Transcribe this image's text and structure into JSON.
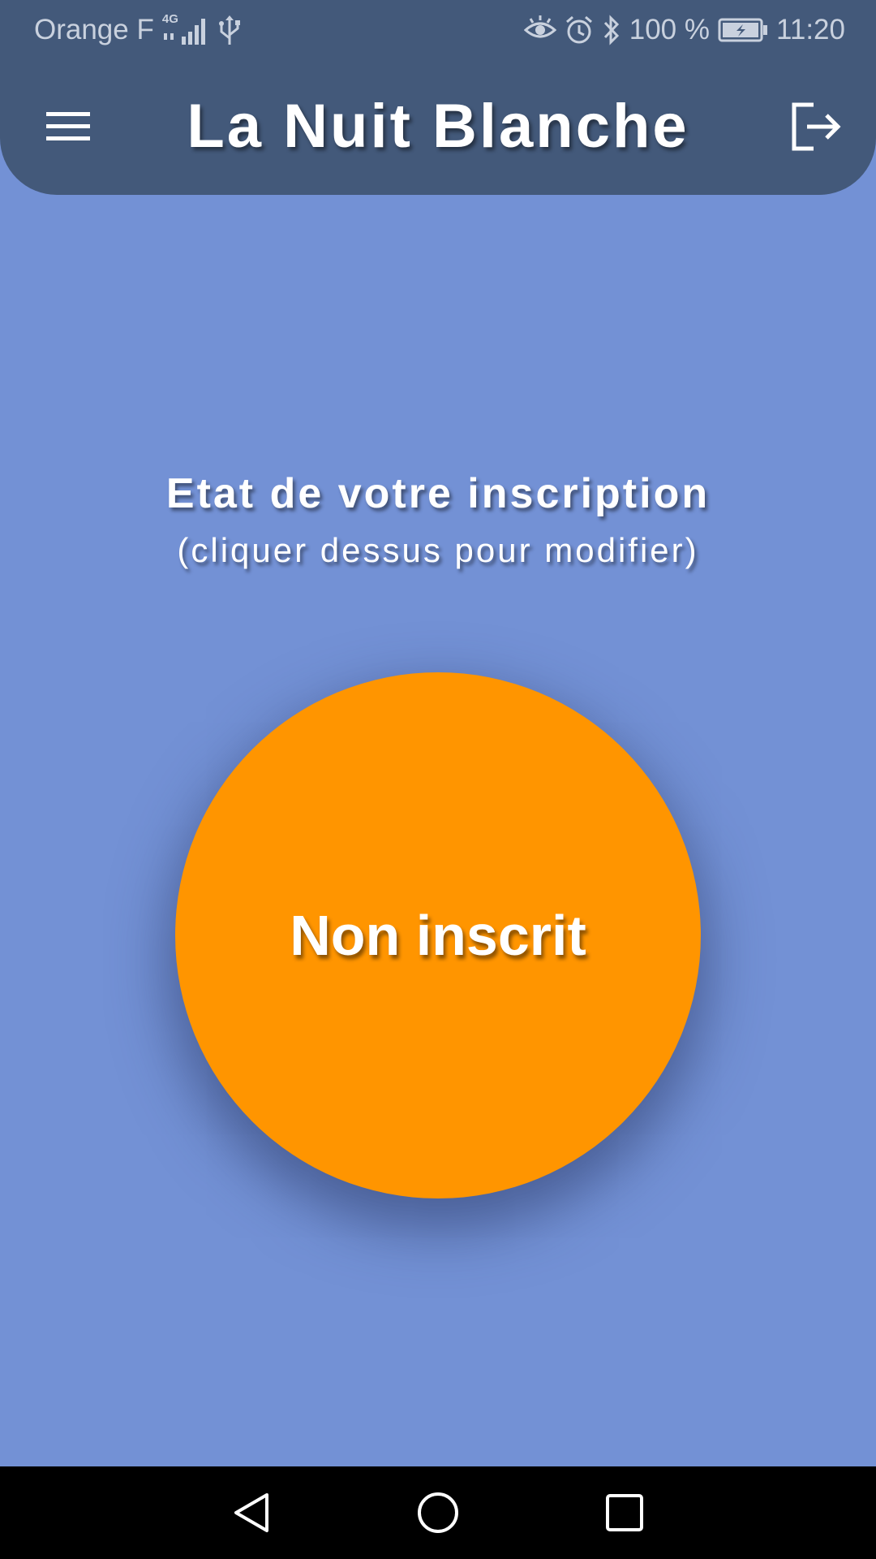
{
  "status_bar": {
    "carrier": "Orange F",
    "network": "4G",
    "battery": "100 %",
    "time": "11:20",
    "icons": [
      "signal-icon",
      "usb-icon",
      "eye-icon",
      "alarm-icon",
      "bluetooth-icon",
      "battery-charging-icon"
    ]
  },
  "app_bar": {
    "title": "La Nuit Blanche",
    "menu_icon": "hamburger-menu-icon",
    "logout_icon": "logout-icon"
  },
  "main": {
    "heading": "Etat de votre inscription",
    "subheading": "(cliquer dessus pour modifier)",
    "status_button": {
      "label": "Non inscrit",
      "color": "#ff9500"
    }
  },
  "nav_bar": {
    "buttons": [
      "back-icon",
      "home-icon",
      "recents-icon"
    ]
  },
  "colors": {
    "background": "#7391d5",
    "header": "#43597a",
    "accent": "#ff9500"
  }
}
